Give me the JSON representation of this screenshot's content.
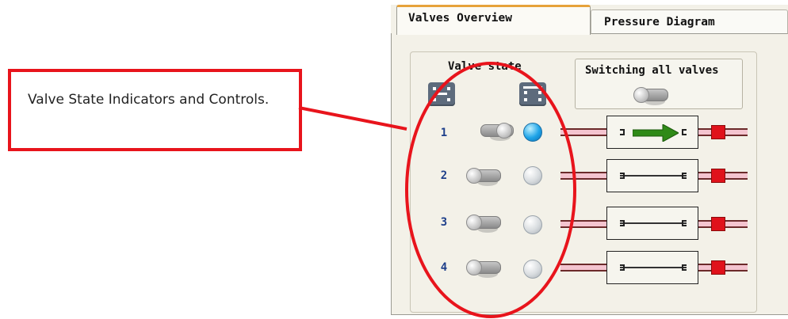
{
  "callout": {
    "text": "Valve State Indicators and Controls."
  },
  "tabs": [
    {
      "label": "Valves Overview",
      "active": true
    },
    {
      "label": "Pressure Diagram",
      "active": false
    }
  ],
  "panel": {
    "valve_state_heading": "Valve state",
    "switch_all_heading": "Switching all valves"
  },
  "state_icons": [
    {
      "icon": "valve-closed-icon"
    },
    {
      "icon": "valve-open-icon"
    }
  ],
  "valves": [
    {
      "number": "1",
      "switch": "on",
      "indicator": "active",
      "flow": true
    },
    {
      "number": "2",
      "switch": "off",
      "indicator": "inactive",
      "flow": false
    },
    {
      "number": "3",
      "switch": "off",
      "indicator": "inactive",
      "flow": false
    },
    {
      "number": "4",
      "switch": "off",
      "indicator": "inactive",
      "flow": false
    }
  ],
  "colors": {
    "annotation_red": "#e8141c",
    "active_tab_accent": "#e6a23a",
    "indicator_on": "#1ea4e8",
    "indicator_off": "#d8dcdf",
    "pipe_fill": "#f4c4cf",
    "pipe_outline": "#6b2a2a",
    "pressure_marker": "#e0121b",
    "flow_arrow": "#2f8a17",
    "row_number": "#1e3f8a"
  }
}
